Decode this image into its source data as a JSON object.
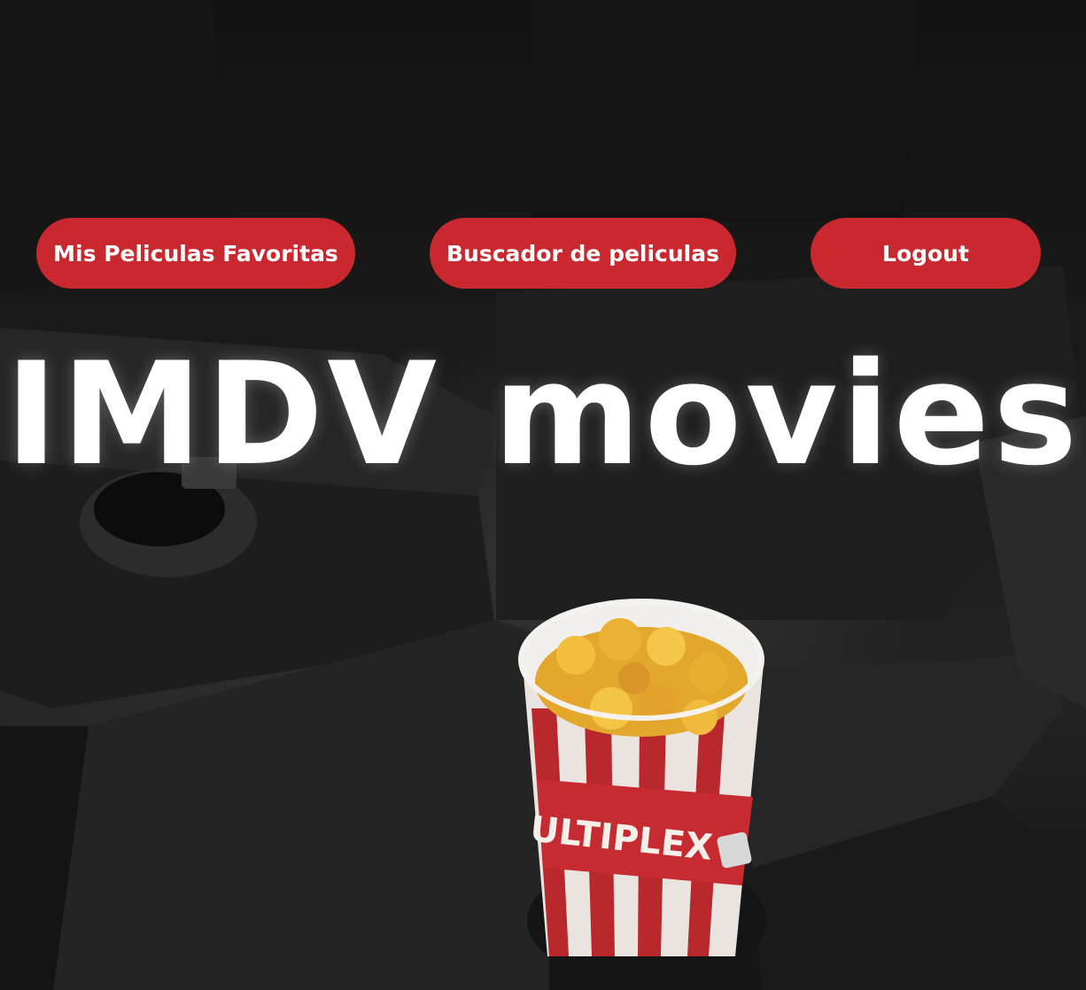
{
  "nav": {
    "favorites_label": "Mis Peliculas Favoritas",
    "search_label": "Buscador de peliculas",
    "logout_label": "Logout"
  },
  "hero": {
    "title": "IMDV movies",
    "cup_text": "ULTIPLEX"
  },
  "colors": {
    "button_bg": "#c8282e",
    "button_text": "#ffffff",
    "title_text": "#ffffff"
  }
}
